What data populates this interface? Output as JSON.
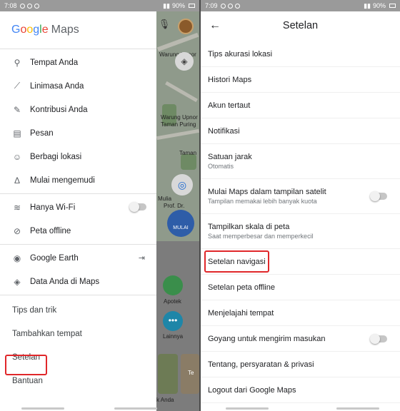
{
  "left": {
    "status": {
      "time": "7:08",
      "battery": "90%"
    },
    "map": {
      "labels": [
        "Warung Upnor",
        "Taman Puring",
        "Taman",
        "Mulia",
        "Prof. Dr.",
        "Apotek",
        "Lainnya",
        "k Anda",
        "Te"
      ],
      "go_label": "MULAI"
    },
    "drawer": {
      "logo": {
        "google": "Google",
        "maps": "Maps"
      },
      "group1": [
        {
          "icon": "place-icon",
          "glyph": "⚲",
          "label": "Tempat Anda"
        },
        {
          "icon": "timeline-icon",
          "glyph": "⟋",
          "label": "Linimasa Anda"
        },
        {
          "icon": "contributions-icon",
          "glyph": "✎",
          "label": "Kontribusi Anda"
        },
        {
          "icon": "message-icon",
          "glyph": "▤",
          "label": "Pesan"
        },
        {
          "icon": "location-share-icon",
          "glyph": "☺",
          "label": "Berbagi lokasi"
        },
        {
          "icon": "navigation-icon",
          "glyph": "Δ",
          "label": "Mulai mengemudi"
        }
      ],
      "group2": [
        {
          "icon": "wifi-icon",
          "glyph": "≋",
          "label": "Hanya Wi-Fi",
          "toggle": true
        },
        {
          "icon": "offline-icon",
          "glyph": "⊘",
          "label": "Peta offline"
        }
      ],
      "group3": [
        {
          "icon": "earth-icon",
          "glyph": "◉",
          "label": "Google Earth",
          "exit": true
        },
        {
          "icon": "shield-icon",
          "glyph": "◈",
          "label": "Data Anda di Maps"
        }
      ],
      "plain": [
        "Tips dan trik",
        "Tambahkan tempat",
        "Setelan",
        "Bantuan"
      ]
    }
  },
  "right": {
    "status": {
      "time": "7:09",
      "battery": "90%"
    },
    "title": "Setelan",
    "settings": [
      {
        "label": "Tips akurasi lokasi"
      },
      {
        "label": "Histori Maps"
      },
      {
        "label": "Akun tertaut"
      },
      {
        "label": "Notifikasi"
      },
      {
        "label": "Satuan jarak",
        "sub": "Otomatis"
      },
      {
        "label": "Mulai Maps dalam tampilan satelit",
        "sub": "Tampilan memakai lebih banyak kuota",
        "toggle": true
      },
      {
        "label": "Tampilkan skala di peta",
        "sub": "Saat memperbesar dan memperkecil"
      },
      {
        "label": "Setelan navigasi"
      },
      {
        "label": "Setelan peta offline"
      },
      {
        "label": "Menjelajahi tempat"
      },
      {
        "label": "Goyang untuk mengirim masukan",
        "toggle": true
      },
      {
        "label": "Tentang, persyaratan & privasi"
      },
      {
        "label": "Logout dari Google Maps"
      }
    ]
  },
  "colors": {
    "highlight": "#e0272a",
    "google_blue": "#4285f4",
    "google_red": "#ea4335",
    "google_yellow": "#fbbc05",
    "google_green": "#34a853"
  }
}
